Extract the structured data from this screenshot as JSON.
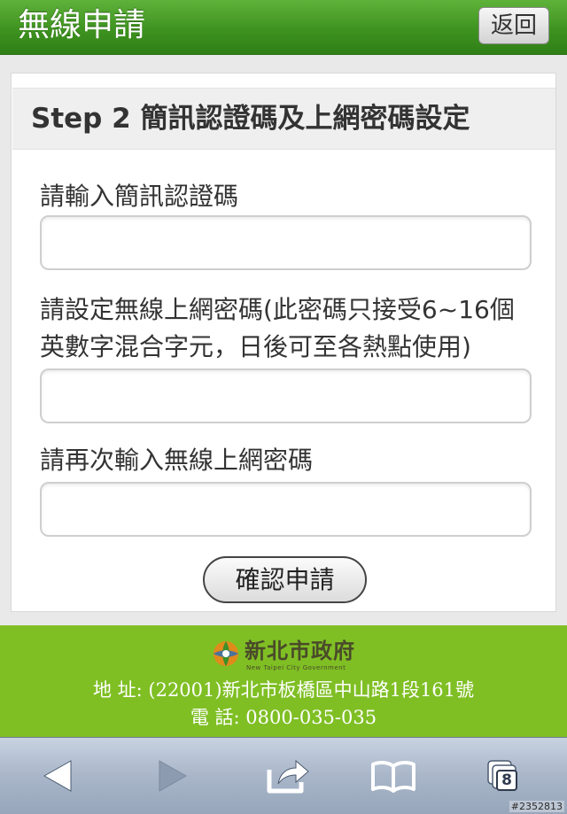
{
  "header": {
    "title": "無線申請",
    "back_label": "返回"
  },
  "form": {
    "step_title": "Step 2 簡訊認證碼及上網密碼設定",
    "sms_code_label": "請輸入簡訊認證碼",
    "sms_code_value": "",
    "password_label_line1": "請設定無線上網密碼(此密碼只接受6~16個",
    "password_label_line2": "英數字混合字元，日後可至各熱點使用)",
    "password_value": "",
    "confirm_password_label": "請再次輸入無線上網密碼",
    "confirm_password_value": "",
    "submit_label": "確認申請"
  },
  "footer": {
    "logo_text": "新北市政府",
    "logo_subtext": "New Taipei City Government",
    "address": "地 址: (22001)新北市板橋區中山路1段161號",
    "phone": "電 話: 0800-035-035"
  },
  "toolbar": {
    "icons": [
      "back-arrow-icon",
      "forward-arrow-icon",
      "share-icon",
      "bookmarks-icon",
      "tabs-icon"
    ],
    "tab_count": "8"
  },
  "watermark": "#2352813",
  "colors": {
    "header_green": "#3e9320",
    "footer_green": "#7fbf24",
    "toolbar_blue": "#a9b6c9"
  }
}
